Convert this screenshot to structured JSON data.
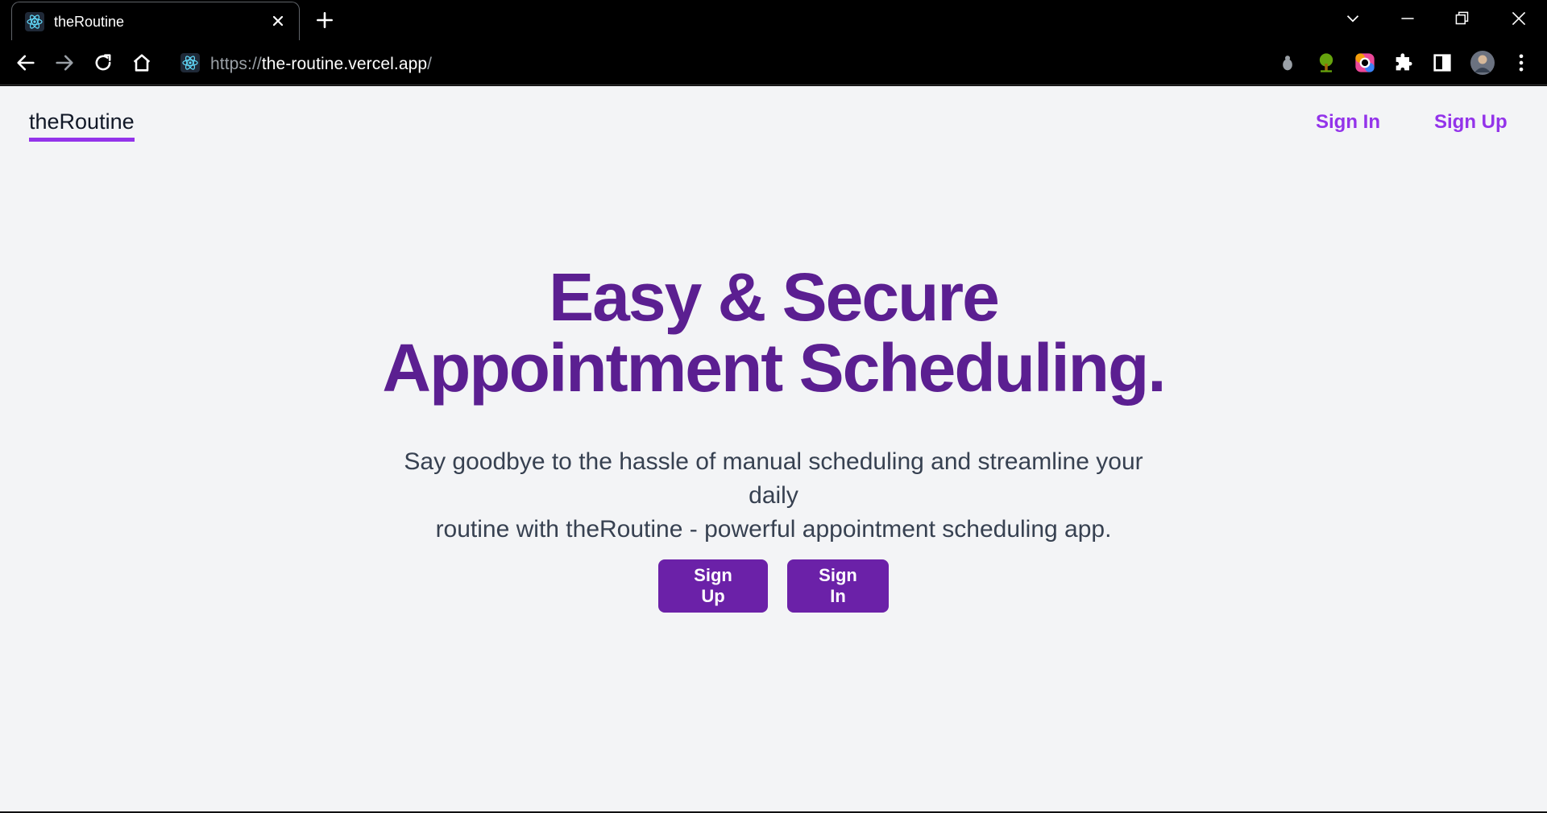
{
  "browser": {
    "tab_title": "theRoutine",
    "url_scheme": "https://",
    "url_host": "the-routine.vercel.app",
    "url_tail": "/"
  },
  "nav": {
    "brand": "theRoutine",
    "sign_in": "Sign In",
    "sign_up": "Sign Up"
  },
  "hero": {
    "headline_line1": "Easy & Secure",
    "headline_line2": "Appointment Scheduling.",
    "subtitle_line1": "Say goodbye to the hassle of manual scheduling and streamline your daily",
    "subtitle_line2": "routine with theRoutine - powerful appointment scheduling app.",
    "cta_sign_up": "Sign Up",
    "cta_sign_in": "Sign In"
  },
  "colors": {
    "accent": "#9333ea",
    "headline": "#5b1f91",
    "button": "#6b21a8",
    "page_bg": "#f3f4f6"
  }
}
